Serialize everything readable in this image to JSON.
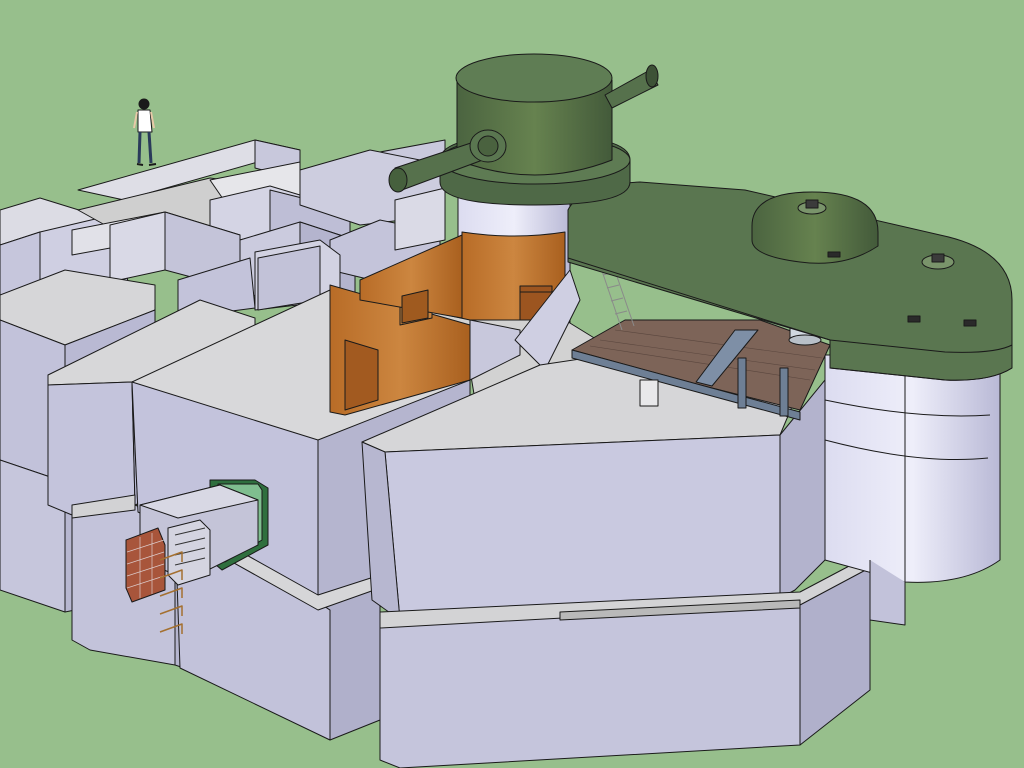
{
  "viewport": {
    "background_color": "#97bf8c"
  },
  "scene": {
    "subject": "3d-model-bunker-with-turrets",
    "colors": {
      "concrete_top": "#d9d9db",
      "concrete_side": "#c4c4d8",
      "concrete_side_dark": "#a9a9c2",
      "interior_floor": "#cfcfcf",
      "wood": "#c0762f",
      "armor_green": "#55704a",
      "armor_green_dark": "#3f5637",
      "steel_blue": "#6e7f95",
      "floor_planks": "#7d6458",
      "brick": "#a8553b",
      "outline": "#1a1a1a"
    },
    "icons": [
      "human-figure-icon",
      "ladder-icon",
      "periscope-icon"
    ]
  }
}
